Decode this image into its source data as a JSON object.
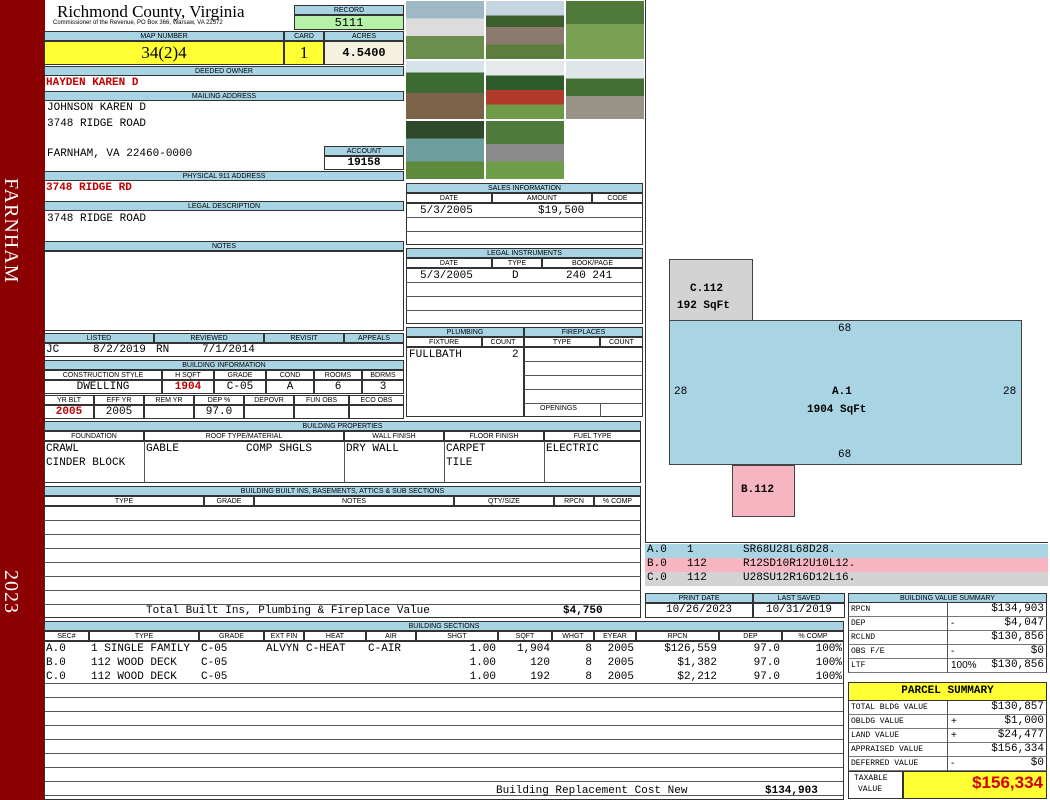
{
  "sidebar": {
    "town": "FARNHAM",
    "year": "2023"
  },
  "header": {
    "county": "Richmond County, Virginia",
    "subtitle": "Commissioner of the Revenue, PO Box 366, Warsaw, VA 22572",
    "record_label": "RECORD",
    "record": "5111",
    "map_label": "MAP NUMBER",
    "map_number": "34(2)4",
    "card_label": "CARD",
    "card": "1",
    "acres_label": "ACRES",
    "acres": "4.5400"
  },
  "owner": {
    "deeded_label": "DEEDED OWNER",
    "deeded": "HAYDEN KAREN D",
    "mailing_label": "MAILING ADDRESS",
    "mail_1": "JOHNSON KAREN D",
    "mail_2": "3748 RIDGE ROAD",
    "mail_3": "FARNHAM, VA 22460-0000",
    "account_label": "ACCOUNT",
    "account": "19158",
    "physical_label": "PHYSICAL 911 ADDRESS",
    "physical": "3748 RIDGE RD",
    "legal_label": "LEGAL DESCRIPTION",
    "legal": "3748 RIDGE ROAD",
    "notes_label": "NOTES"
  },
  "review": {
    "listed_label": "LISTED",
    "reviewed_label": "REVIEWED",
    "revisit_label": "REVISIT",
    "appeals_label": "APPEALS",
    "listed_by": "JC",
    "listed_date": "8/2/2019",
    "reviewed_by": "RN",
    "reviewed_date": "7/1/2014"
  },
  "building_info": {
    "label": "BUILDING INFORMATION",
    "h": [
      "CONSTRUCTION STYLE",
      "H SQFT",
      "GRADE",
      "COND",
      "ROOMS",
      "BDRMS"
    ],
    "v": [
      "DWELLING",
      "1904",
      "C-05",
      "A",
      "6",
      "3"
    ],
    "h2": [
      "YR BLT",
      "EFF YR",
      "REM YR",
      "DEP %",
      "DEPOVR",
      "FUN OBS",
      "ECO OBS"
    ],
    "v2": [
      "2005",
      "2005",
      "",
      "97.0",
      "",
      "",
      ""
    ]
  },
  "sales": {
    "label": "SALES INFORMATION",
    "h": [
      "DATE",
      "AMOUNT",
      "CODE"
    ],
    "date": "5/3/2005",
    "amount": "$19,500",
    "code": ""
  },
  "legal_instruments": {
    "label": "LEGAL INSTRUMENTS",
    "h": [
      "DATE",
      "TYPE",
      "BOOK/PAGE"
    ],
    "date": "5/3/2005",
    "type": "D",
    "book": "240 241"
  },
  "plumbing": {
    "label": "PLUMBING",
    "h": [
      "FIXTURE",
      "COUNT"
    ],
    "fixture": "FULLBATH",
    "count": "2"
  },
  "fireplaces": {
    "label": "FIREPLACES",
    "h": [
      "TYPE",
      "COUNT"
    ],
    "openings": "OPENINGS"
  },
  "properties": {
    "label": "BUILDING PROPERTIES",
    "h": [
      "FOUNDATION",
      "ROOF TYPE/MATERIAL",
      "WALL FINISH",
      "FLOOR FINISH",
      "FUEL TYPE"
    ],
    "foundation_1": "CRAWL",
    "foundation_2": "CINDER BLOCK",
    "roof_type": "GABLE",
    "roof_material": "COMP SHGLS",
    "wall": "DRY WALL",
    "floor_1": "CARPET",
    "floor_2": "TILE",
    "fuel": "ELECTRIC"
  },
  "builtins": {
    "label": "BUILDING BUILT INS, BASEMENTS, ATTICS & SUB SECTIONS",
    "h": [
      "TYPE",
      "GRADE",
      "NOTES",
      "QTY/SIZE",
      "RPCN",
      "% COMP"
    ],
    "total_label": "Total Built Ins, Plumbing & Fireplace Value",
    "total": "$4,750"
  },
  "sketch": {
    "c_label": "C.112",
    "c_area": "192 SqFt",
    "a_label": "A.1",
    "a_area": "1904 SqFt",
    "b_label": "B.112",
    "top": "68",
    "bottom": "68",
    "left": "28",
    "right": "28"
  },
  "vectors": [
    {
      "sec": "A.0",
      "code": "1",
      "vec": "SR68U28L68D28.",
      "color": "#a9d4e4"
    },
    {
      "sec": "B.0",
      "code": "112",
      "vec": "R12SD10R12U10L12.",
      "color": "#f6b5c1"
    },
    {
      "sec": "C.0",
      "code": "112",
      "vec": "U28SU12R16D12L16.",
      "color": "#d3d3d3"
    }
  ],
  "dates": {
    "print_label": "PRINT DATE",
    "print": "10/26/2023",
    "saved_label": "LAST SAVED",
    "saved": "10/31/2019"
  },
  "sections": {
    "label": "BUILDING SECTIONS",
    "h": [
      "SEC#",
      "TYPE",
      "GRADE",
      "EXT FIN",
      "HEAT",
      "AIR",
      "SHGT",
      "SQFT",
      "WHGT",
      "EYEAR",
      "RPCN",
      "DEP",
      "% COMP"
    ],
    "rows": [
      [
        "A.0",
        "1 SINGLE FAMILY",
        "C-05",
        "ALVYN",
        "C-HEAT",
        "C-AIR",
        "1.00",
        "1,904",
        "8",
        "2005",
        "$126,559",
        "97.0",
        "100%"
      ],
      [
        "B.0",
        "112 WOOD DECK",
        "C-05",
        "",
        "",
        "",
        "1.00",
        "120",
        "8",
        "2005",
        "$1,382",
        "97.0",
        "100%"
      ],
      [
        "C.0",
        "112 WOOD DECK",
        "C-05",
        "",
        "",
        "",
        "1.00",
        "192",
        "8",
        "2005",
        "$2,212",
        "97.0",
        "100%"
      ]
    ],
    "replacement_label": "Building Replacement Cost New",
    "replacement": "$134,903"
  },
  "value_summary": {
    "label": "BUILDING VALUE SUMMARY",
    "rows": [
      {
        "l": "RPCN",
        "s": "",
        "v": "$134,903"
      },
      {
        "l": "DEP",
        "s": "-",
        "v": "$4,047"
      },
      {
        "l": "RCLND",
        "s": "",
        "v": "$130,856"
      },
      {
        "l": "OBS F/E",
        "s": "-",
        "v": "$0"
      },
      {
        "l": "LTF",
        "s": "100%",
        "v": "$130,856"
      }
    ]
  },
  "parcel": {
    "label": "PARCEL SUMMARY",
    "rows": [
      {
        "l": "TOTAL BLDG VALUE",
        "s": "",
        "v": "$130,857"
      },
      {
        "l": "OBLDG VALUE",
        "s": "+",
        "v": "$1,000"
      },
      {
        "l": "LAND VALUE",
        "s": "+",
        "v": "$24,477"
      },
      {
        "l": "APPRAISED VALUE",
        "s": "",
        "v": "$156,334"
      },
      {
        "l": "DEFERRED VALUE",
        "s": "-",
        "v": "$0"
      }
    ],
    "taxable_label_1": "TAXABLE",
    "taxable_label_2": "VALUE",
    "taxable": "$156,334"
  }
}
